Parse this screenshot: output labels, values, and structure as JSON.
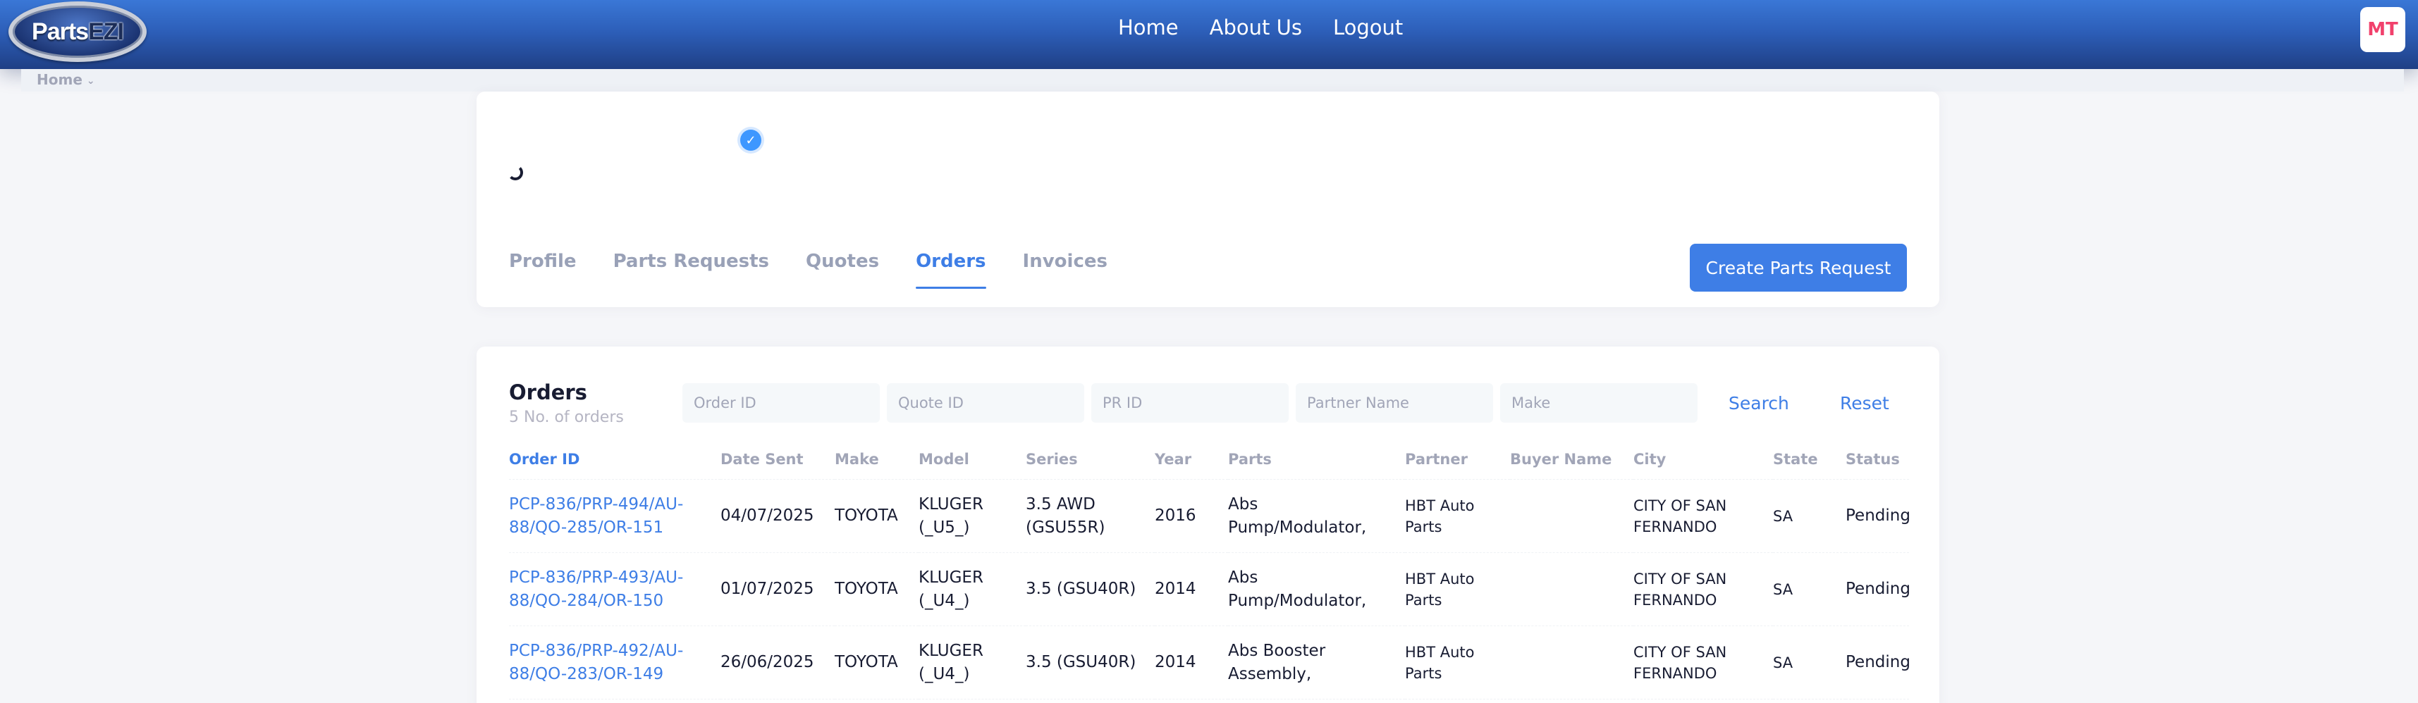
{
  "header": {
    "logo_text_main": "Parts",
    "logo_text_accent": "EZI",
    "nav": [
      "Home",
      "About Us",
      "Logout"
    ],
    "avatar_initials": "MT"
  },
  "breadcrumb": {
    "item": "Home"
  },
  "profile": {
    "verified_icon": "check-badge-icon",
    "tabs": [
      "Profile",
      "Parts Requests",
      "Quotes",
      "Orders",
      "Invoices"
    ],
    "active_tab": "Orders",
    "create_button": "Create Parts Request"
  },
  "orders": {
    "title": "Orders",
    "subtitle": "5 No. of orders",
    "filters": {
      "order_id": "Order ID",
      "quote_id": "Quote ID",
      "pr_id": "PR ID",
      "partner_name": "Partner Name",
      "make": "Make"
    },
    "search_label": "Search",
    "reset_label": "Reset",
    "columns": [
      "Order ID",
      "Date Sent",
      "Make",
      "Model",
      "Series",
      "Year",
      "Parts",
      "Partner",
      "Buyer Name",
      "City",
      "State",
      "Status"
    ],
    "rows": [
      {
        "order_id": "PCP-836/PRP-494/AU-88/QO-285/OR-151",
        "date_sent": "04/07/2025",
        "make": "TOYOTA",
        "model": "KLUGER (_U5_)",
        "series": "3.5 AWD (GSU55R)",
        "year": "2016",
        "parts": "Abs Pump/Modulator,",
        "partner": "HBT Auto Parts",
        "buyer_name": "",
        "city": "CITY OF SAN FERNANDO",
        "state": "SA",
        "status": "Pending"
      },
      {
        "order_id": "PCP-836/PRP-493/AU-88/QO-284/OR-150",
        "date_sent": "01/07/2025",
        "make": "TOYOTA",
        "model": "KLUGER (_U4_)",
        "series": "3.5 (GSU40R)",
        "year": "2014",
        "parts": "Abs Pump/Modulator,",
        "partner": "HBT Auto Parts",
        "buyer_name": "",
        "city": "CITY OF SAN FERNANDO",
        "state": "SA",
        "status": "Pending"
      },
      {
        "order_id": "PCP-836/PRP-492/AU-88/QO-283/OR-149",
        "date_sent": "26/06/2025",
        "make": "TOYOTA",
        "model": "KLUGER (_U4_)",
        "series": "3.5 (GSU40R)",
        "year": "2014",
        "parts": "Abs Booster Assembly,",
        "partner": "HBT Auto Parts",
        "buyer_name": "",
        "city": "CITY OF SAN FERNANDO",
        "state": "SA",
        "status": "Pending"
      }
    ]
  }
}
